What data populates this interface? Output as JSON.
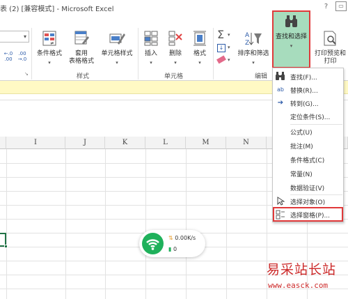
{
  "window": {
    "title": "表 (2)  [兼容模式] - Microsoft Excel",
    "help_icon": "?",
    "ribbon_toggle_icon": "▭"
  },
  "ribbon": {
    "number": {
      "decrease_decimal": "←.0\n.00",
      "increase_decimal": ".00\n→.0"
    },
    "styles_group": {
      "label": "样式",
      "conditional_format": "条件格式",
      "table_format": "套用\n表格格式",
      "cell_styles": "单元格样式"
    },
    "cells_group": {
      "label": "单元格",
      "insert": "插入",
      "delete": "删除",
      "format": "格式"
    },
    "editing_group": {
      "label": "编辑",
      "sort_filter": "排序和筛选",
      "find_select": "查找和选择"
    },
    "print_preview": "打印预览和\n打印"
  },
  "grid": {
    "columns": [
      "I",
      "J",
      "K",
      "L",
      "M",
      "N"
    ]
  },
  "find_menu": {
    "items": [
      {
        "label": "查找(F)...",
        "icon": "binoculars-icon"
      },
      {
        "label": "替换(R)...",
        "icon": "replace-icon"
      },
      {
        "label": "转到(G)...",
        "icon": "arrow-right-icon"
      },
      {
        "label": "定位条件(S)..."
      },
      {
        "label": "公式(U)"
      },
      {
        "label": "批注(M)"
      },
      {
        "label": "条件格式(C)"
      },
      {
        "label": "常量(N)"
      },
      {
        "label": "数据验证(V)"
      },
      {
        "label": "选择对象(O)",
        "icon": "cursor-icon"
      },
      {
        "label": "选择窗格(P)...",
        "icon": "selection-pane-icon"
      }
    ]
  },
  "network_widget": {
    "upload": "0.00K/s",
    "download": "0"
  },
  "watermark": {
    "line1": "易采站长站",
    "line2": "www.easck.com"
  },
  "colors": {
    "accent_green": "#217346",
    "find_highlight": "#a7dcbd",
    "highlight_border": "#e0393a",
    "wifi_green": "#1fb15b",
    "watermark": "#cc2a2a"
  }
}
